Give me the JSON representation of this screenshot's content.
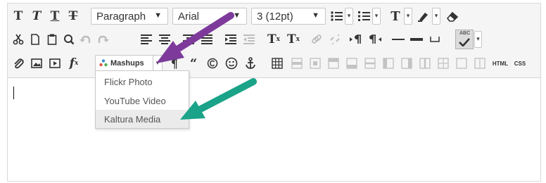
{
  "colors": {
    "purple_arrow": "#7d3a9b",
    "teal_arrow": "#1aa388",
    "toolbar_bg": "#f5f5f5"
  },
  "row1": {
    "bold_label": "T",
    "italic_label": "T",
    "underline_label": "T",
    "strike_label": "T",
    "format_value": "Paragraph",
    "font_value": "Arial",
    "size_value": "3 (12pt)",
    "text_color_label": "T"
  },
  "row2": {
    "superscript_base": "T",
    "superscript_mark": "x",
    "clear_format_base": "T",
    "clear_format_mark": "x",
    "spellcheck_label": "ABC"
  },
  "row3": {
    "function_base": "f",
    "function_sub": "x",
    "mashups_label": "Mashups",
    "html_label": "HTML",
    "css_label": "CSS"
  },
  "mashups_menu": {
    "items": [
      "Flickr Photo",
      "YouTube Video",
      "Kaltura Media"
    ]
  }
}
